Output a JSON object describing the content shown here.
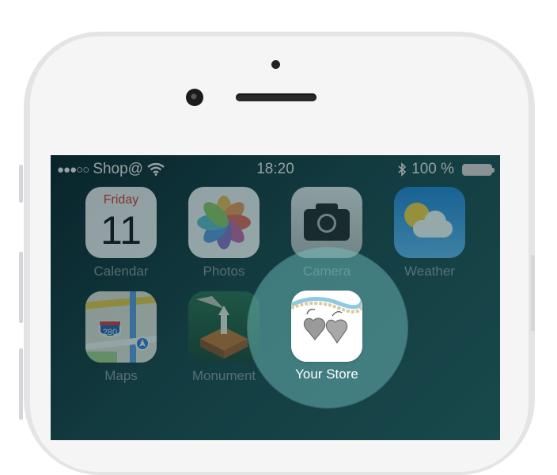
{
  "status_bar": {
    "signal_dots": "●●●○○",
    "carrier": "Shop@",
    "time": "18:20",
    "battery_percent": "100 %"
  },
  "apps": {
    "calendar": {
      "label": "Calendar",
      "day": "Friday",
      "date": "11"
    },
    "photos": {
      "label": "Photos"
    },
    "camera": {
      "label": "Camera"
    },
    "weather": {
      "label": "Weather"
    },
    "maps": {
      "label": "Maps",
      "shield": "280"
    },
    "monument": {
      "label": "Monument"
    },
    "your_store": {
      "label": "Your Store"
    }
  },
  "icons": [
    "wifi-icon",
    "bluetooth-icon",
    "battery-icon",
    "calendar-icon",
    "photos-icon",
    "camera-icon",
    "weather-icon",
    "maps-icon",
    "monument-icon",
    "store-icon"
  ],
  "colors": {
    "highlight": "#78c8c8",
    "calendar_red": "#e53b30",
    "screen_bg": "#17494f"
  }
}
